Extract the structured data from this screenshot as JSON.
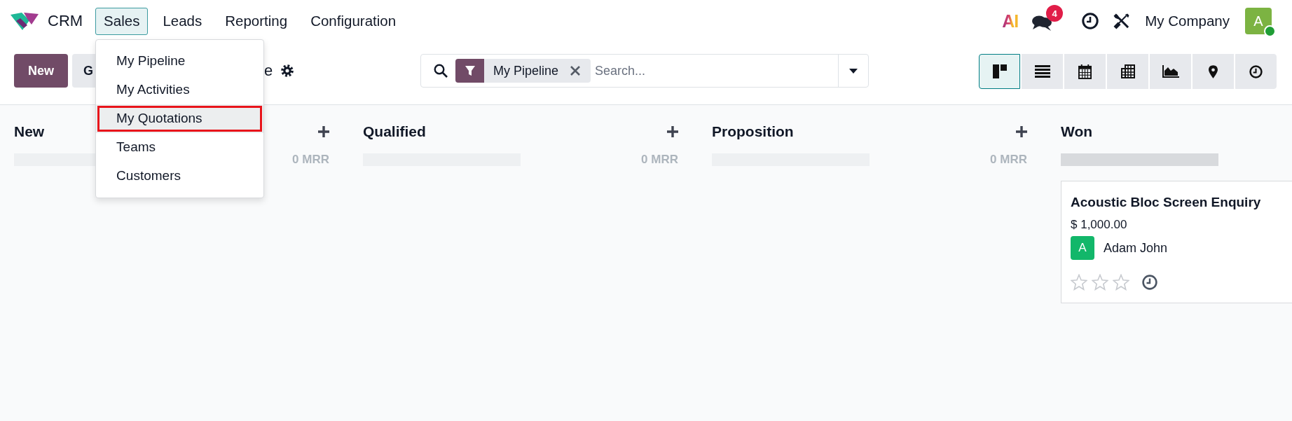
{
  "navbar": {
    "app_name": "CRM",
    "menus": [
      {
        "label": "Sales",
        "selected": true
      },
      {
        "label": "Leads",
        "selected": false
      },
      {
        "label": "Reporting",
        "selected": false
      },
      {
        "label": "Configuration",
        "selected": false
      }
    ],
    "ai_label": "AI",
    "messages_badge": "4",
    "company": "My Company",
    "user_initial": "A",
    "user_online": true
  },
  "dropdown": {
    "items": [
      {
        "label": "My Pipeline",
        "selected": false
      },
      {
        "label": "My Activities",
        "selected": false
      },
      {
        "label": "My Quotations",
        "selected": true
      },
      {
        "label": "Teams",
        "selected": false
      },
      {
        "label": "Customers",
        "selected": false
      }
    ]
  },
  "control_panel": {
    "new_button": "New",
    "generate_button": "G",
    "title": "e",
    "search": {
      "facet": "My Pipeline",
      "placeholder": "Search..."
    },
    "views": [
      {
        "kind": "kanban",
        "selected": true
      },
      {
        "kind": "list",
        "selected": false
      },
      {
        "kind": "calendar",
        "selected": false
      },
      {
        "kind": "pivot",
        "selected": false
      },
      {
        "kind": "graph",
        "selected": false
      },
      {
        "kind": "map",
        "selected": false
      },
      {
        "kind": "activity",
        "selected": false
      }
    ]
  },
  "kanban": {
    "columns": [
      {
        "name": "New",
        "quick_create": true,
        "bar": {
          "color": "#eef0f2"
        },
        "total": "0 MRR"
      },
      {
        "name": "Qualified",
        "quick_create": true,
        "bar": {
          "color": "#eef0f2"
        },
        "total": "0 MRR"
      },
      {
        "name": "Proposition",
        "quick_create": true,
        "bar": {
          "color": "#eef0f2"
        },
        "total": "0 MRR"
      },
      {
        "name": "Won",
        "quick_create": false,
        "bar": {
          "color": "#d8dadd"
        },
        "cards": [
          {
            "title": "Acoustic Bloc Screen Enquiry",
            "amount": "$ 1,000.00",
            "salesperson_initial": "A",
            "salesperson": "Adam John",
            "stars": 0
          }
        ]
      }
    ]
  }
}
